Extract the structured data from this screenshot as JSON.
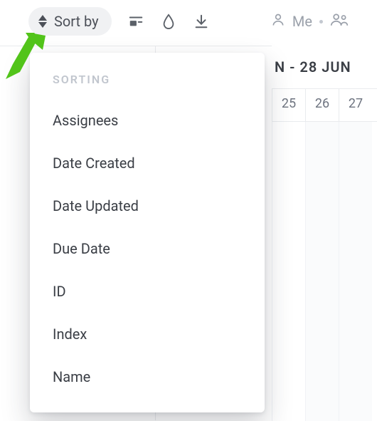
{
  "toolbar": {
    "sort_label": "Sort by",
    "me_label": "Me"
  },
  "sort_popover": {
    "section_label": "SORTING",
    "items": [
      {
        "label": "Assignees"
      },
      {
        "label": "Date Created"
      },
      {
        "label": "Date Updated"
      },
      {
        "label": "Due Date"
      },
      {
        "label": "ID"
      },
      {
        "label": "Index"
      },
      {
        "label": "Name"
      }
    ]
  },
  "calendar": {
    "range_label": "N - 28 JUN",
    "days": [
      "25",
      "26",
      "27"
    ]
  }
}
